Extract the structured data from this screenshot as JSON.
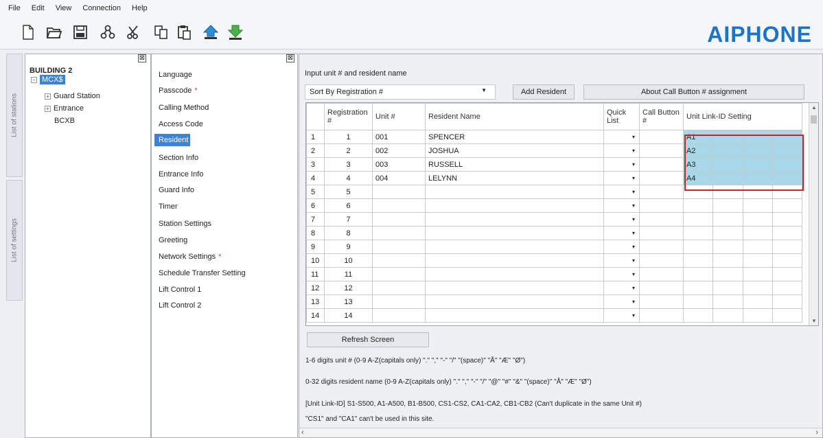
{
  "menu": [
    "File",
    "Edit",
    "View",
    "Connection",
    "Help"
  ],
  "toolbar": {
    "buttons": [
      "new-file-icon",
      "open-folder-icon",
      "save-icon",
      "network-icon",
      "cut-icon",
      "copy-icon",
      "paste-icon",
      "upload-icon",
      "download-icon"
    ],
    "logo": "AIPHONE",
    "logo_color": "#1d73c4"
  },
  "side_tabs": {
    "stations": "List of stations",
    "settings": "List of settings"
  },
  "tree": {
    "root": "BUILDING 2",
    "selected": "MCX$",
    "children": [
      "Guard Station",
      "Entrance",
      "BCXB"
    ],
    "close": "⊠"
  },
  "settings": {
    "close": "⊠",
    "items": [
      {
        "label": "Language",
        "required": ""
      },
      {
        "label": "Passcode",
        "required": "*"
      },
      {
        "label": "Calling Method",
        "required": ""
      },
      {
        "label": "Access Code",
        "required": ""
      },
      {
        "label": "Resident",
        "required": ""
      },
      {
        "label": "Section Info",
        "required": ""
      },
      {
        "label": "Entrance Info",
        "required": ""
      },
      {
        "label": "Guard Info",
        "required": ""
      },
      {
        "label": "Timer",
        "required": ""
      },
      {
        "label": "Station Settings",
        "required": ""
      },
      {
        "label": "Greeting",
        "required": ""
      },
      {
        "label": "Network Settings",
        "required": "*"
      },
      {
        "label": "Schedule Transfer Setting",
        "required": ""
      },
      {
        "label": "Lift Control 1",
        "required": ""
      },
      {
        "label": "Lift Control 2",
        "required": ""
      }
    ],
    "selected": "Resident"
  },
  "main": {
    "title": "Input unit # and resident name",
    "sort_value": "Sort By Registration #",
    "add_button": "Add Resident",
    "about_button": "About Call Button # assignment",
    "refresh_button": "Refresh Screen"
  },
  "table": {
    "headers": {
      "registration": "Registration #",
      "unit": "Unit #",
      "name": "Resident Name",
      "quick": "Quick List",
      "call_button": "Call Button #",
      "link_id": "Unit Link-ID Setting"
    },
    "rows": [
      {
        "idx": "1",
        "reg": "1",
        "unit": "001",
        "name": "SPENCER",
        "link": "A1"
      },
      {
        "idx": "2",
        "reg": "2",
        "unit": "002",
        "name": "JOSHUA",
        "link": "A2"
      },
      {
        "idx": "3",
        "reg": "3",
        "unit": "003",
        "name": "RUSSELL",
        "link": "A3"
      },
      {
        "idx": "4",
        "reg": "4",
        "unit": "004",
        "name": "LELYNN",
        "link": "A4"
      },
      {
        "idx": "5",
        "reg": "5",
        "unit": "",
        "name": "",
        "link": ""
      },
      {
        "idx": "6",
        "reg": "6",
        "unit": "",
        "name": "",
        "link": ""
      },
      {
        "idx": "7",
        "reg": "7",
        "unit": "",
        "name": "",
        "link": ""
      },
      {
        "idx": "8",
        "reg": "8",
        "unit": "",
        "name": "",
        "link": ""
      },
      {
        "idx": "9",
        "reg": "9",
        "unit": "",
        "name": "",
        "link": ""
      },
      {
        "idx": "10",
        "reg": "10",
        "unit": "",
        "name": "",
        "link": ""
      },
      {
        "idx": "11",
        "reg": "11",
        "unit": "",
        "name": "",
        "link": ""
      },
      {
        "idx": "12",
        "reg": "12",
        "unit": "",
        "name": "",
        "link": ""
      },
      {
        "idx": "13",
        "reg": "13",
        "unit": "",
        "name": "",
        "link": ""
      },
      {
        "idx": "14",
        "reg": "14",
        "unit": "",
        "name": "",
        "link": ""
      }
    ],
    "quick_glyph": "▾",
    "link_highlight_color": "#a8d8e8"
  },
  "notes": {
    "unit_rule": "1-6 digits unit # (0-9 A-Z(capitals only) \".\" \",\" \"-\" \"/\" \"(space)\" \"Å\" \"Æ\" \"Ø\")",
    "name_rule": "0-32 digits resident name (0-9 A-Z(capitals only) \".\" \",\" \"-\" \"/\" \"@\" \"#\" \"&\" \"(space)\" \"Å\" \"Æ\" \"Ø\")",
    "link_rule": "[Unit Link-ID] S1-S500, A1-A500, B1-B500, CS1-CS2, CA1-CA2, CB1-CB2 (Can't duplicate in the same Unit #)",
    "site_rule": "\"CS1\" and \"CA1\" can't be used in this site."
  }
}
